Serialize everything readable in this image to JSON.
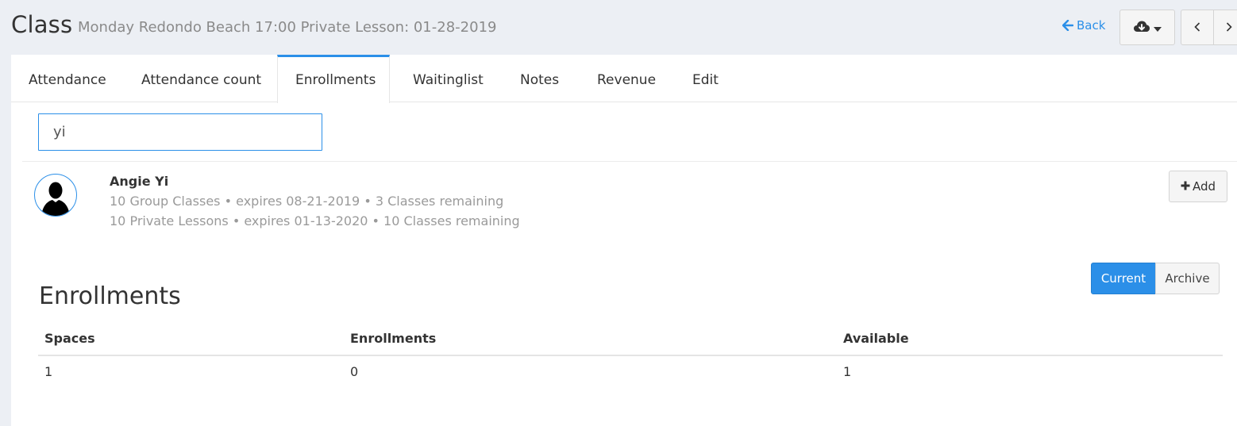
{
  "header": {
    "title": "Class",
    "subtitle": "Monday Redondo Beach 17:00 Private Lesson: 01-28-2019",
    "back_label": "Back"
  },
  "tabs": [
    {
      "label": "Attendance",
      "active": false
    },
    {
      "label": "Attendance count",
      "active": false
    },
    {
      "label": "Enrollments",
      "active": true
    },
    {
      "label": "Waitinglist",
      "active": false
    },
    {
      "label": "Notes",
      "active": false
    },
    {
      "label": "Revenue",
      "active": false
    },
    {
      "label": "Edit",
      "active": false
    }
  ],
  "search": {
    "value": "yi",
    "placeholder": ""
  },
  "result": {
    "name": "Angie Yi",
    "packages": [
      "10 Group Classes • expires 08-21-2019 • 3 Classes remaining",
      "10 Private Lessons • expires 01-13-2020 • 10 Classes remaining"
    ],
    "add_label": "Add"
  },
  "filter": {
    "current_label": "Current",
    "archive_label": "Archive"
  },
  "enrollments": {
    "title": "Enrollments",
    "columns": [
      "Spaces",
      "Enrollments",
      "Available"
    ],
    "rows": [
      [
        "1",
        "0",
        "1"
      ]
    ]
  },
  "colors": {
    "accent": "#2b8fe8",
    "background": "#eceff4",
    "muted_text": "#9a9a9a"
  },
  "icons": {
    "back": "arrow-left-icon",
    "download": "cloud-download-icon",
    "caret": "caret-down-icon",
    "prev": "chevron-left-icon",
    "next": "chevron-right-icon",
    "add": "plus-icon",
    "avatar": "user-silhouette-icon"
  }
}
